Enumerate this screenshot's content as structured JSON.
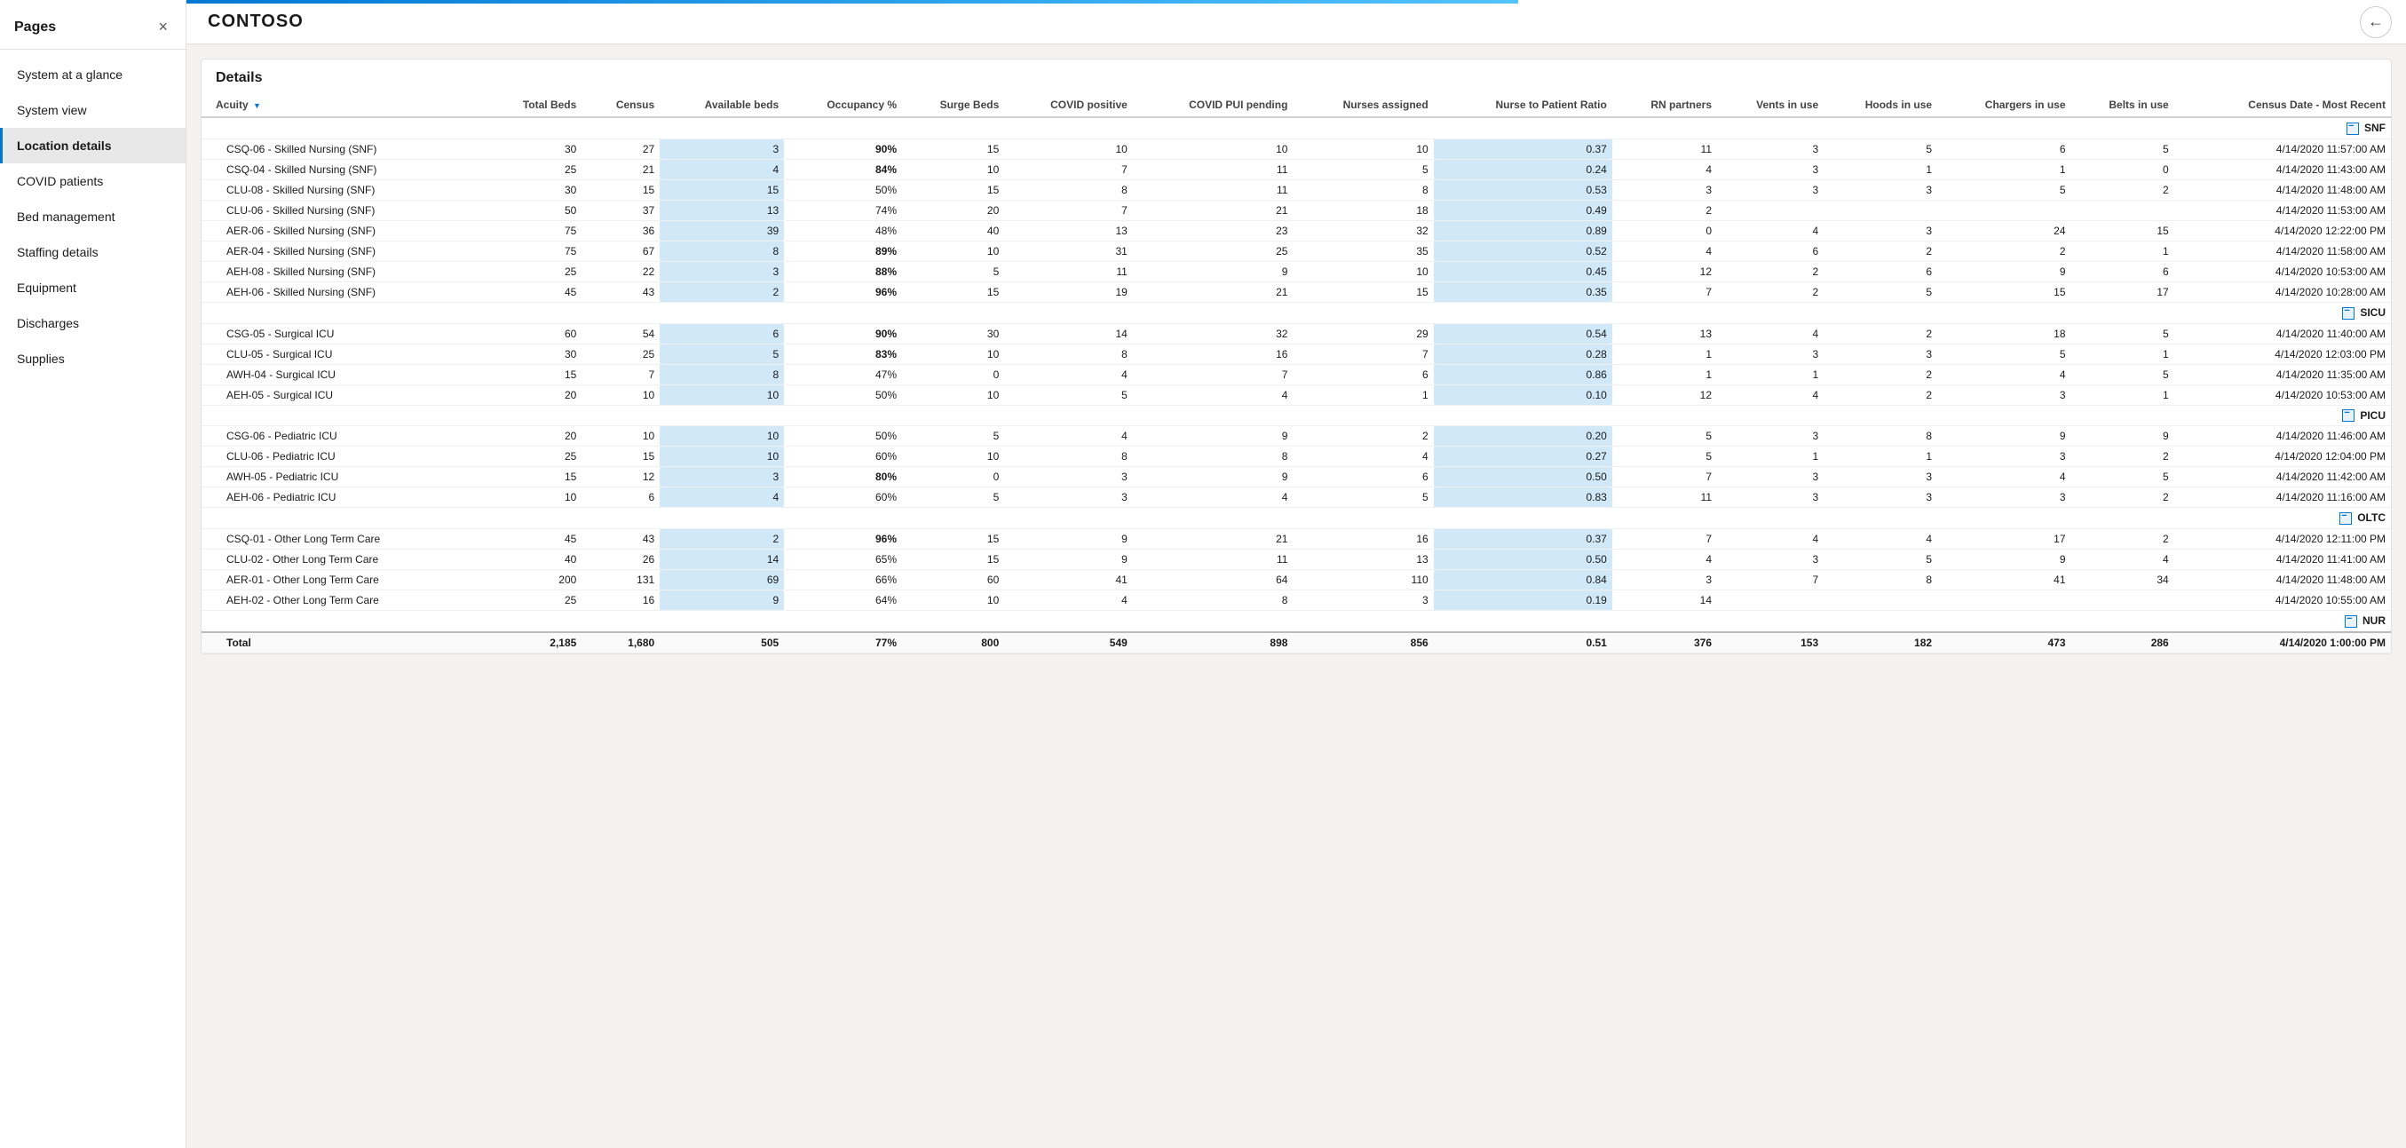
{
  "sidebar": {
    "title": "Pages",
    "close_label": "×",
    "items": [
      {
        "label": "System at a glance",
        "active": false
      },
      {
        "label": "System view",
        "active": false
      },
      {
        "label": "Location details",
        "active": true
      },
      {
        "label": "COVID patients",
        "active": false
      },
      {
        "label": "Bed management",
        "active": false
      },
      {
        "label": "Staffing details",
        "active": false
      },
      {
        "label": "Equipment",
        "active": false
      },
      {
        "label": "Discharges",
        "active": false
      },
      {
        "label": "Supplies",
        "active": false
      }
    ]
  },
  "topbar": {
    "title": "CONTOSO",
    "back_icon": "←"
  },
  "details": {
    "heading": "Details",
    "columns": [
      {
        "key": "acuity",
        "label": "Acuity",
        "align": "left"
      },
      {
        "key": "total_beds",
        "label": "Total Beds",
        "align": "right"
      },
      {
        "key": "census",
        "label": "Census",
        "align": "right"
      },
      {
        "key": "available_beds",
        "label": "Available beds",
        "align": "right"
      },
      {
        "key": "occupancy_pct",
        "label": "Occupancy %",
        "align": "right"
      },
      {
        "key": "surge_beds",
        "label": "Surge Beds",
        "align": "right"
      },
      {
        "key": "covid_positive",
        "label": "COVID positive",
        "align": "right"
      },
      {
        "key": "covid_pui_pending",
        "label": "COVID PUI pending",
        "align": "right"
      },
      {
        "key": "nurses_assigned",
        "label": "Nurses assigned",
        "align": "right"
      },
      {
        "key": "nurse_patient_ratio",
        "label": "Nurse to Patient Ratio",
        "align": "right"
      },
      {
        "key": "rn_partners",
        "label": "RN partners",
        "align": "right"
      },
      {
        "key": "vents_in_use",
        "label": "Vents in use",
        "align": "right"
      },
      {
        "key": "hoods_in_use",
        "label": "Hoods in use",
        "align": "right"
      },
      {
        "key": "chargers_in_use",
        "label": "Chargers in use",
        "align": "right"
      },
      {
        "key": "belts_in_use",
        "label": "Belts in use",
        "align": "right"
      },
      {
        "key": "census_date",
        "label": "Census Date - Most Recent",
        "align": "right"
      }
    ],
    "groups": [
      {
        "name": "SNF",
        "rows": [
          {
            "acuity": "CSQ-06 - Skilled Nursing (SNF)",
            "total_beds": 30,
            "census": 27,
            "available_beds": 3,
            "available_highlight": true,
            "occupancy_pct": "90%",
            "occ_red": true,
            "surge_beds": 15,
            "covid_positive": 10,
            "covid_pui_pending": 10,
            "nurses_assigned": 10,
            "nurse_patient_ratio": "0.37",
            "ratio_highlight": true,
            "rn_partners": 11,
            "vents_in_use": 3,
            "hoods_in_use": 5,
            "chargers_in_use": 6,
            "belts_in_use": 5,
            "census_date": "4/14/2020 11:57:00 AM",
            "date_red": true
          },
          {
            "acuity": "CSQ-04 - Skilled Nursing (SNF)",
            "total_beds": 25,
            "census": 21,
            "available_beds": 4,
            "available_highlight": true,
            "occupancy_pct": "84%",
            "occ_red": true,
            "surge_beds": 10,
            "covid_positive": 7,
            "covid_pui_pending": 11,
            "nurses_assigned": 5,
            "nurse_patient_ratio": "0.24",
            "ratio_highlight": true,
            "rn_partners": 4,
            "vents_in_use": 3,
            "hoods_in_use": 1,
            "chargers_in_use": 1,
            "belts_in_use": 0,
            "census_date": "4/14/2020 11:43:00 AM",
            "date_red": true
          },
          {
            "acuity": "CLU-08 - Skilled Nursing (SNF)",
            "total_beds": 30,
            "census": 15,
            "available_beds": 15,
            "available_highlight": true,
            "occupancy_pct": "50%",
            "occ_red": false,
            "surge_beds": 15,
            "covid_positive": 8,
            "covid_pui_pending": 11,
            "nurses_assigned": 8,
            "nurse_patient_ratio": "0.53",
            "ratio_highlight": true,
            "rn_partners": 3,
            "vents_in_use": 3,
            "hoods_in_use": 3,
            "chargers_in_use": 5,
            "belts_in_use": 2,
            "census_date": "4/14/2020 11:48:00 AM",
            "date_red": true
          },
          {
            "acuity": "CLU-06 - Skilled Nursing (SNF)",
            "total_beds": 50,
            "census": 37,
            "available_beds": 13,
            "available_highlight": true,
            "occupancy_pct": "74%",
            "occ_red": false,
            "surge_beds": 20,
            "covid_positive": 7,
            "covid_pui_pending": 21,
            "nurses_assigned": 18,
            "nurse_patient_ratio": "0.49",
            "ratio_highlight": true,
            "rn_partners": 2,
            "vents_in_use": "",
            "hoods_in_use": "",
            "chargers_in_use": "",
            "belts_in_use": "",
            "census_date": "4/14/2020 11:53:00 AM",
            "date_red": true
          },
          {
            "acuity": "AER-06 - Skilled Nursing (SNF)",
            "total_beds": 75,
            "census": 36,
            "available_beds": 39,
            "available_highlight": true,
            "occupancy_pct": "48%",
            "occ_red": false,
            "surge_beds": 40,
            "covid_positive": 13,
            "covid_pui_pending": 23,
            "nurses_assigned": 32,
            "nurse_patient_ratio": "0.89",
            "ratio_highlight": true,
            "rn_partners": 0,
            "vents_in_use": 4,
            "hoods_in_use": 3,
            "chargers_in_use": 24,
            "belts_in_use": 15,
            "census_date": "4/14/2020 12:22:00 PM",
            "date_red": true
          },
          {
            "acuity": "AER-04 - Skilled Nursing (SNF)",
            "total_beds": 75,
            "census": 67,
            "available_beds": 8,
            "available_highlight": true,
            "occupancy_pct": "89%",
            "occ_red": true,
            "surge_beds": 10,
            "covid_positive": 31,
            "covid_pui_pending": 25,
            "nurses_assigned": 35,
            "nurse_patient_ratio": "0.52",
            "ratio_highlight": true,
            "rn_partners": 4,
            "vents_in_use": 6,
            "hoods_in_use": 2,
            "chargers_in_use": 2,
            "belts_in_use": 1,
            "census_date": "4/14/2020 11:58:00 AM",
            "date_red": true
          },
          {
            "acuity": "AEH-08 - Skilled Nursing (SNF)",
            "total_beds": 25,
            "census": 22,
            "available_beds": 3,
            "available_highlight": true,
            "occupancy_pct": "88%",
            "occ_red": true,
            "surge_beds": 5,
            "covid_positive": 11,
            "covid_pui_pending": 9,
            "nurses_assigned": 10,
            "nurse_patient_ratio": "0.45",
            "ratio_highlight": true,
            "rn_partners": 12,
            "vents_in_use": 2,
            "hoods_in_use": 6,
            "chargers_in_use": 9,
            "belts_in_use": 6,
            "census_date": "4/14/2020 10:53:00 AM",
            "date_red": true
          },
          {
            "acuity": "AEH-06 - Skilled Nursing (SNF)",
            "total_beds": 45,
            "census": 43,
            "available_beds": 2,
            "available_highlight": true,
            "occupancy_pct": "96%",
            "occ_red": true,
            "surge_beds": 15,
            "covid_positive": 19,
            "covid_pui_pending": 21,
            "nurses_assigned": 15,
            "nurse_patient_ratio": "0.35",
            "ratio_highlight": true,
            "rn_partners": 7,
            "vents_in_use": 2,
            "hoods_in_use": 5,
            "chargers_in_use": 15,
            "belts_in_use": 17,
            "census_date": "4/14/2020 10:28:00 AM",
            "date_red": true
          }
        ]
      },
      {
        "name": "SICU",
        "rows": [
          {
            "acuity": "CSG-05 - Surgical ICU",
            "total_beds": 60,
            "census": 54,
            "available_beds": 6,
            "available_highlight": true,
            "occupancy_pct": "90%",
            "occ_red": true,
            "surge_beds": 30,
            "covid_positive": 14,
            "covid_pui_pending": 32,
            "nurses_assigned": 29,
            "nurse_patient_ratio": "0.54",
            "ratio_highlight": true,
            "rn_partners": 13,
            "vents_in_use": 4,
            "hoods_in_use": 2,
            "chargers_in_use": 18,
            "belts_in_use": 5,
            "census_date": "4/14/2020 11:40:00 AM",
            "date_red": true
          },
          {
            "acuity": "CLU-05 - Surgical ICU",
            "total_beds": 30,
            "census": 25,
            "available_beds": 5,
            "available_highlight": true,
            "occupancy_pct": "83%",
            "occ_red": true,
            "surge_beds": 10,
            "covid_positive": 8,
            "covid_pui_pending": 16,
            "nurses_assigned": 7,
            "nurse_patient_ratio": "0.28",
            "ratio_highlight": true,
            "rn_partners": 1,
            "vents_in_use": 3,
            "hoods_in_use": 3,
            "chargers_in_use": 5,
            "belts_in_use": 1,
            "census_date": "4/14/2020 12:03:00 PM",
            "date_red": true
          },
          {
            "acuity": "AWH-04 - Surgical ICU",
            "total_beds": 15,
            "census": 7,
            "available_beds": 8,
            "available_highlight": true,
            "occupancy_pct": "47%",
            "occ_red": false,
            "surge_beds": 0,
            "covid_positive": 4,
            "covid_pui_pending": 7,
            "nurses_assigned": 6,
            "nurse_patient_ratio": "0.86",
            "ratio_highlight": true,
            "rn_partners": 1,
            "vents_in_use": 1,
            "hoods_in_use": 2,
            "chargers_in_use": 4,
            "belts_in_use": 5,
            "census_date": "4/14/2020 11:35:00 AM",
            "date_red": true
          },
          {
            "acuity": "AEH-05 - Surgical ICU",
            "total_beds": 20,
            "census": 10,
            "available_beds": 10,
            "available_highlight": true,
            "occupancy_pct": "50%",
            "occ_red": false,
            "surge_beds": 10,
            "covid_positive": 5,
            "covid_pui_pending": 4,
            "nurses_assigned": 1,
            "nurse_patient_ratio": "0.10",
            "ratio_highlight": true,
            "rn_partners": 12,
            "vents_in_use": 4,
            "hoods_in_use": 2,
            "chargers_in_use": 3,
            "belts_in_use": 1,
            "census_date": "4/14/2020 10:53:00 AM",
            "date_red": true
          }
        ]
      },
      {
        "name": "PICU",
        "rows": [
          {
            "acuity": "CSG-06 - Pediatric ICU",
            "total_beds": 20,
            "census": 10,
            "available_beds": 10,
            "available_highlight": true,
            "occupancy_pct": "50%",
            "occ_red": false,
            "surge_beds": 5,
            "covid_positive": 4,
            "covid_pui_pending": 9,
            "nurses_assigned": 2,
            "nurse_patient_ratio": "0.20",
            "ratio_highlight": true,
            "rn_partners": 5,
            "vents_in_use": 3,
            "hoods_in_use": 8,
            "chargers_in_use": 9,
            "belts_in_use": 9,
            "census_date": "4/14/2020 11:46:00 AM",
            "date_red": true
          },
          {
            "acuity": "CLU-06 - Pediatric ICU",
            "total_beds": 25,
            "census": 15,
            "available_beds": 10,
            "available_highlight": true,
            "occupancy_pct": "60%",
            "occ_red": false,
            "surge_beds": 10,
            "covid_positive": 8,
            "covid_pui_pending": 8,
            "nurses_assigned": 4,
            "nurse_patient_ratio": "0.27",
            "ratio_highlight": true,
            "rn_partners": 5,
            "vents_in_use": 1,
            "hoods_in_use": 1,
            "chargers_in_use": 3,
            "belts_in_use": 2,
            "census_date": "4/14/2020 12:04:00 PM",
            "date_red": true
          },
          {
            "acuity": "AWH-05 - Pediatric ICU",
            "total_beds": 15,
            "census": 12,
            "available_beds": 3,
            "available_highlight": true,
            "occupancy_pct": "80%",
            "occ_red": true,
            "surge_beds": 0,
            "covid_positive": 3,
            "covid_pui_pending": 9,
            "nurses_assigned": 6,
            "nurse_patient_ratio": "0.50",
            "ratio_highlight": true,
            "rn_partners": 7,
            "vents_in_use": 3,
            "hoods_in_use": 3,
            "chargers_in_use": 4,
            "belts_in_use": 5,
            "census_date": "4/14/2020 11:42:00 AM",
            "date_red": true
          },
          {
            "acuity": "AEH-06 - Pediatric ICU",
            "total_beds": 10,
            "census": 6,
            "available_beds": 4,
            "available_highlight": true,
            "occupancy_pct": "60%",
            "occ_red": false,
            "surge_beds": 5,
            "covid_positive": 3,
            "covid_pui_pending": 4,
            "nurses_assigned": 5,
            "nurse_patient_ratio": "0.83",
            "ratio_highlight": true,
            "rn_partners": 11,
            "vents_in_use": 3,
            "hoods_in_use": 3,
            "chargers_in_use": 3,
            "belts_in_use": 2,
            "census_date": "4/14/2020 11:16:00 AM",
            "date_red": true
          }
        ]
      },
      {
        "name": "OLTC",
        "rows": [
          {
            "acuity": "CSQ-01 - Other Long Term Care",
            "total_beds": 45,
            "census": 43,
            "available_beds": 2,
            "available_highlight": true,
            "occupancy_pct": "96%",
            "occ_red": true,
            "surge_beds": 15,
            "covid_positive": 9,
            "covid_pui_pending": 21,
            "nurses_assigned": 16,
            "nurse_patient_ratio": "0.37",
            "ratio_highlight": true,
            "rn_partners": 7,
            "vents_in_use": 4,
            "hoods_in_use": 4,
            "chargers_in_use": 17,
            "belts_in_use": 2,
            "census_date": "4/14/2020 12:11:00 PM",
            "date_red": true
          },
          {
            "acuity": "CLU-02 - Other Long Term Care",
            "total_beds": 40,
            "census": 26,
            "available_beds": 14,
            "available_highlight": true,
            "occupancy_pct": "65%",
            "occ_red": false,
            "surge_beds": 15,
            "covid_positive": 9,
            "covid_pui_pending": 11,
            "nurses_assigned": 13,
            "nurse_patient_ratio": "0.50",
            "ratio_highlight": true,
            "rn_partners": 4,
            "vents_in_use": 3,
            "hoods_in_use": 5,
            "chargers_in_use": 9,
            "belts_in_use": 4,
            "census_date": "4/14/2020 11:41:00 AM",
            "date_red": true
          },
          {
            "acuity": "AER-01 - Other Long Term Care",
            "total_beds": 200,
            "census": 131,
            "available_beds": 69,
            "available_highlight": true,
            "occupancy_pct": "66%",
            "occ_red": false,
            "surge_beds": 60,
            "covid_positive": 41,
            "covid_pui_pending": 64,
            "nurses_assigned": 110,
            "nurse_patient_ratio": "0.84",
            "ratio_highlight": true,
            "rn_partners": 3,
            "vents_in_use": 7,
            "hoods_in_use": 8,
            "chargers_in_use": 41,
            "belts_in_use": 34,
            "census_date": "4/14/2020 11:48:00 AM",
            "date_red": true
          },
          {
            "acuity": "AEH-02 - Other Long Term Care",
            "total_beds": 25,
            "census": 16,
            "available_beds": 9,
            "available_highlight": true,
            "occupancy_pct": "64%",
            "occ_red": false,
            "surge_beds": 10,
            "covid_positive": 4,
            "covid_pui_pending": 8,
            "nurses_assigned": 3,
            "nurse_patient_ratio": "0.19",
            "ratio_highlight": true,
            "rn_partners": 14,
            "vents_in_use": "",
            "hoods_in_use": "",
            "chargers_in_use": "",
            "belts_in_use": "",
            "census_date": "4/14/2020 10:55:00 AM",
            "date_red": true
          }
        ]
      },
      {
        "name": "NUR",
        "rows": []
      }
    ],
    "total_row": {
      "label": "Total",
      "total_beds": "2,185",
      "census": "1,680",
      "available_beds": "505",
      "occupancy_pct": "77%",
      "surge_beds": "800",
      "covid_positive": "549",
      "covid_pui_pending": "898",
      "nurses_assigned": "856",
      "nurse_patient_ratio": "0.51",
      "rn_partners": "376",
      "vents_in_use": "153",
      "hoods_in_use": "182",
      "chargers_in_use": "473",
      "belts_in_use": "286",
      "census_date": "4/14/2020 1:00:00 PM"
    }
  }
}
